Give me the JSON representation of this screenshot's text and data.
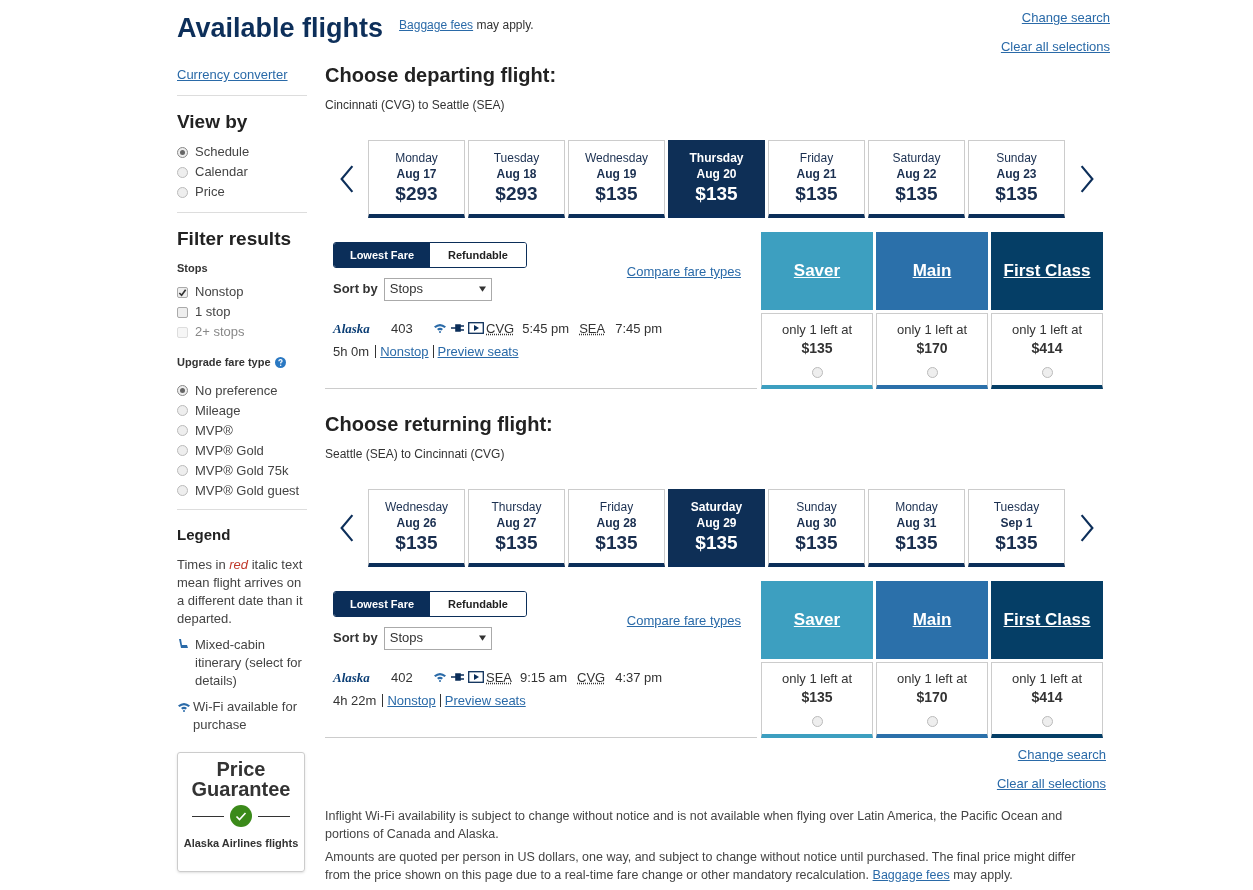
{
  "header": {
    "title": "Available flights",
    "baggage_link": "Baggage fees",
    "baggage_suffix": "may apply.",
    "change_search": "Change search",
    "clear_selections": "Clear all selections"
  },
  "sidebar": {
    "currency_link": "Currency converter",
    "view_by": {
      "heading": "View by",
      "options": [
        {
          "label": "Schedule",
          "selected": true
        },
        {
          "label": "Calendar",
          "selected": false
        },
        {
          "label": "Price",
          "selected": false
        }
      ]
    },
    "filter": {
      "heading": "Filter results",
      "stops_label": "Stops",
      "stops": [
        {
          "label": "Nonstop",
          "checked": true,
          "disabled": false
        },
        {
          "label": "1 stop",
          "checked": false,
          "disabled": false
        },
        {
          "label": "2+ stops",
          "checked": false,
          "disabled": true
        }
      ],
      "upgrade_label": "Upgrade fare type",
      "upgrade_options": [
        {
          "label": "No preference",
          "selected": true
        },
        {
          "label": "Mileage",
          "selected": false
        },
        {
          "label": "MVP®",
          "selected": false
        },
        {
          "label": "MVP® Gold",
          "selected": false
        },
        {
          "label": "MVP® Gold 75k",
          "selected": false
        },
        {
          "label": "MVP® Gold guest",
          "selected": false
        }
      ]
    },
    "legend": {
      "heading": "Legend",
      "text_before": "Times in",
      "red_word": "red",
      "text_after": "italic text mean flight arrives on a different date than it departed.",
      "items": [
        {
          "kind": "mixed-cabin",
          "text": "Mixed-cabin itinerary (select for details)"
        },
        {
          "kind": "wifi",
          "text": "Wi-Fi available for purchase"
        }
      ]
    },
    "guarantee": {
      "title": "Price Guarantee",
      "caption": "Alaska Airlines flights"
    }
  },
  "sections": [
    {
      "title": "Choose departing flight:",
      "route": "Cincinnati (CVG) to Seattle (SEA)",
      "dates": [
        {
          "day": "Monday",
          "date": "Aug 17",
          "price": "$293",
          "selected": false
        },
        {
          "day": "Tuesday",
          "date": "Aug 18",
          "price": "$293",
          "selected": false
        },
        {
          "day": "Wednesday",
          "date": "Aug 19",
          "price": "$135",
          "selected": false
        },
        {
          "day": "Thursday",
          "date": "Aug 20",
          "price": "$135",
          "selected": true
        },
        {
          "day": "Friday",
          "date": "Aug 21",
          "price": "$135",
          "selected": false
        },
        {
          "day": "Saturday",
          "date": "Aug 22",
          "price": "$135",
          "selected": false
        },
        {
          "day": "Sunday",
          "date": "Aug 23",
          "price": "$135",
          "selected": false
        }
      ],
      "fare_toggle": [
        {
          "label": "Lowest Fare",
          "selected": true
        },
        {
          "label": "Refundable",
          "selected": false
        }
      ],
      "sort_label": "Sort by",
      "sort_value": "Stops",
      "compare_link": "Compare fare types",
      "fare_columns": [
        {
          "label": "Saver",
          "color": "#3d9fc0"
        },
        {
          "label": "Main",
          "color": "#2b70aa"
        },
        {
          "label": "First Class",
          "color": "#053e66"
        }
      ],
      "flight": {
        "airline": "Alaska",
        "number": "403",
        "from": "CVG",
        "depart": "5:45 pm",
        "to": "SEA",
        "arrive": "7:45 pm",
        "duration": "5h 0m",
        "stops_link": "Nonstop",
        "seats_link": "Preview seats",
        "fares": [
          {
            "availability": "only 1 left at",
            "price": "$135",
            "selected": false
          },
          {
            "availability": "only 1 left at",
            "price": "$170",
            "selected": false
          },
          {
            "availability": "only 1 left at",
            "price": "$414",
            "selected": false
          }
        ]
      }
    },
    {
      "title": "Choose returning flight:",
      "route": "Seattle (SEA) to Cincinnati (CVG)",
      "dates": [
        {
          "day": "Wednesday",
          "date": "Aug 26",
          "price": "$135",
          "selected": false
        },
        {
          "day": "Thursday",
          "date": "Aug 27",
          "price": "$135",
          "selected": false
        },
        {
          "day": "Friday",
          "date": "Aug 28",
          "price": "$135",
          "selected": false
        },
        {
          "day": "Saturday",
          "date": "Aug 29",
          "price": "$135",
          "selected": true
        },
        {
          "day": "Sunday",
          "date": "Aug 30",
          "price": "$135",
          "selected": false
        },
        {
          "day": "Monday",
          "date": "Aug 31",
          "price": "$135",
          "selected": false
        },
        {
          "day": "Tuesday",
          "date": "Sep 1",
          "price": "$135",
          "selected": false
        }
      ],
      "fare_toggle": [
        {
          "label": "Lowest Fare",
          "selected": true
        },
        {
          "label": "Refundable",
          "selected": false
        }
      ],
      "sort_label": "Sort by",
      "sort_value": "Stops",
      "compare_link": "Compare fare types",
      "fare_columns": [
        {
          "label": "Saver",
          "color": "#3d9fc0"
        },
        {
          "label": "Main",
          "color": "#2b70aa"
        },
        {
          "label": "First Class",
          "color": "#053e66"
        }
      ],
      "flight": {
        "airline": "Alaska",
        "number": "402",
        "from": "SEA",
        "depart": "9:15 am",
        "to": "CVG",
        "arrive": "4:37 pm",
        "duration": "4h 22m",
        "stops_link": "Nonstop",
        "seats_link": "Preview seats",
        "fares": [
          {
            "availability": "only 1 left at",
            "price": "$135",
            "selected": false
          },
          {
            "availability": "only 1 left at",
            "price": "$170",
            "selected": false
          },
          {
            "availability": "only 1 left at",
            "price": "$414",
            "selected": false
          }
        ]
      }
    }
  ],
  "footer": {
    "change_search": "Change search",
    "clear_selections": "Clear all selections",
    "notes": [
      {
        "text": "Inflight Wi-Fi availability is subject to change without notice and is not available when flying over Latin America, the Pacific Ocean and portions of Canada and Alaska."
      },
      {
        "text": "Amounts are quoted per person in US dollars, one way, and subject to change without notice until purchased. The final price might differ from the price shown on this page due to a real-time fare change or other mandatory recalculation.",
        "link": "Baggage fees",
        "suffix": "may apply."
      }
    ]
  }
}
